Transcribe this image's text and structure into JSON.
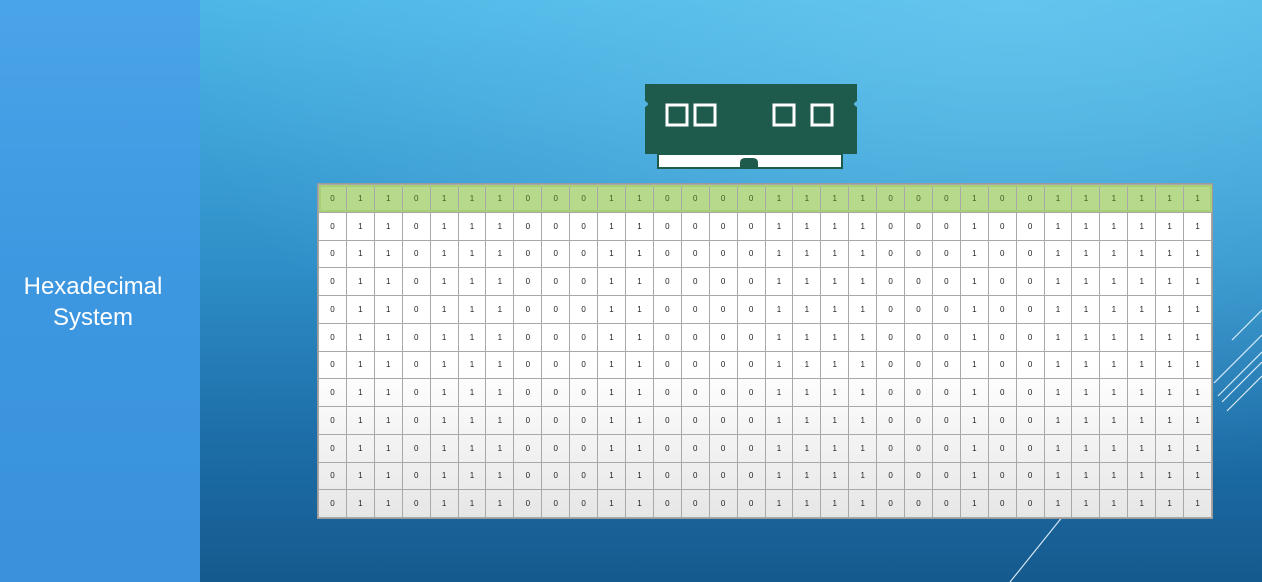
{
  "slide": {
    "title_line1": "Hexadecimal",
    "title_line2": "System"
  },
  "colors": {
    "background_top": "#4cb6e6",
    "background_bottom": "#155a8e",
    "left_panel": "#3d97e0",
    "ram_green": "#1f5b4c",
    "highlight_row": "#b7d98b"
  },
  "icons": [
    "ram-module-icon"
  ],
  "memory_grid": {
    "highlighted_row": 0,
    "bits": [
      "0",
      "1",
      "1",
      "0",
      "1",
      "1",
      "1",
      "0",
      "0",
      "0",
      "1",
      "1",
      "0",
      "0",
      "0",
      "0",
      "1",
      "1",
      "1",
      "1",
      "0",
      "0",
      "0",
      "1",
      "0",
      "0",
      "1",
      "1",
      "1",
      "1",
      "1",
      "1"
    ],
    "row_count": 12
  }
}
